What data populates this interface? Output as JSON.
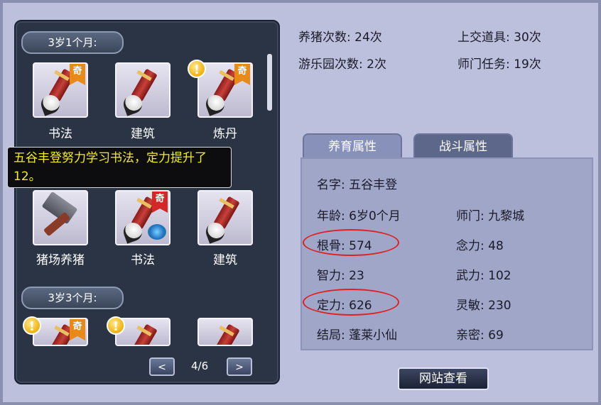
{
  "sections": [
    {
      "header": "3岁1个月:"
    },
    {
      "header": "3岁3个月:"
    }
  ],
  "rows": [
    {
      "items": [
        {
          "label": "书法",
          "icon": "brush-icon",
          "badge": "奇",
          "badge_color": "#e88a1a",
          "alert": false
        },
        {
          "label": "建筑",
          "icon": "brush-icon",
          "badge": "",
          "alert": false
        },
        {
          "label": "炼丹",
          "icon": "brush-icon",
          "badge": "奇",
          "badge_color": "#e88a1a",
          "alert": true,
          "alert_text": "!"
        }
      ]
    },
    {
      "items": [
        {
          "label": "猪场养猪",
          "icon": "hammer-icon",
          "badge": "",
          "alert": false
        },
        {
          "label": "书法",
          "icon": "brush-icon",
          "badge": "奇",
          "badge_color": "#d42828",
          "alert": false
        },
        {
          "label": "建筑",
          "icon": "brush-icon",
          "badge": "",
          "alert": false
        }
      ]
    },
    {
      "items": [
        {
          "label": "",
          "icon": "brush-icon",
          "badge": "奇",
          "badge_color": "#e88a1a",
          "alert": true,
          "alert_text": "!"
        },
        {
          "label": "",
          "icon": "brush-icon",
          "badge": "",
          "alert": true,
          "alert_text": "!"
        },
        {
          "label": "",
          "icon": "brush-icon",
          "badge": "",
          "alert": false
        }
      ]
    }
  ],
  "tooltip": {
    "text": "五谷丰登努力学习书法，定力提升了12。"
  },
  "pager": {
    "prev_label": "<",
    "next_label": ">",
    "page": "4/6"
  },
  "stats": {
    "pig_raising": "养猪次数: 24次",
    "items_submitted": "上交道具: 30次",
    "amusement_park": "游乐园次数: 2次",
    "sect_tasks": "师门任务: 19次"
  },
  "tabs": {
    "nurture": "养育属性",
    "combat": "战斗属性"
  },
  "attributes": {
    "name": "名字: 五谷丰登",
    "age": "年龄: 6岁0个月",
    "sect": "师门: 九黎城",
    "root_bone": "根骨: 574",
    "mind_power": "念力: 48",
    "intelligence": "智力: 23",
    "martial": "武力: 102",
    "composure": "定力: 626",
    "agility": "灵敏: 230",
    "ending": "结局: 蓬莱小仙",
    "intimacy": "亲密: 69"
  },
  "website_button": "网站查看",
  "colors": {
    "highlight_circle": "#e02020",
    "tooltip_text": "#f4ef1a"
  }
}
